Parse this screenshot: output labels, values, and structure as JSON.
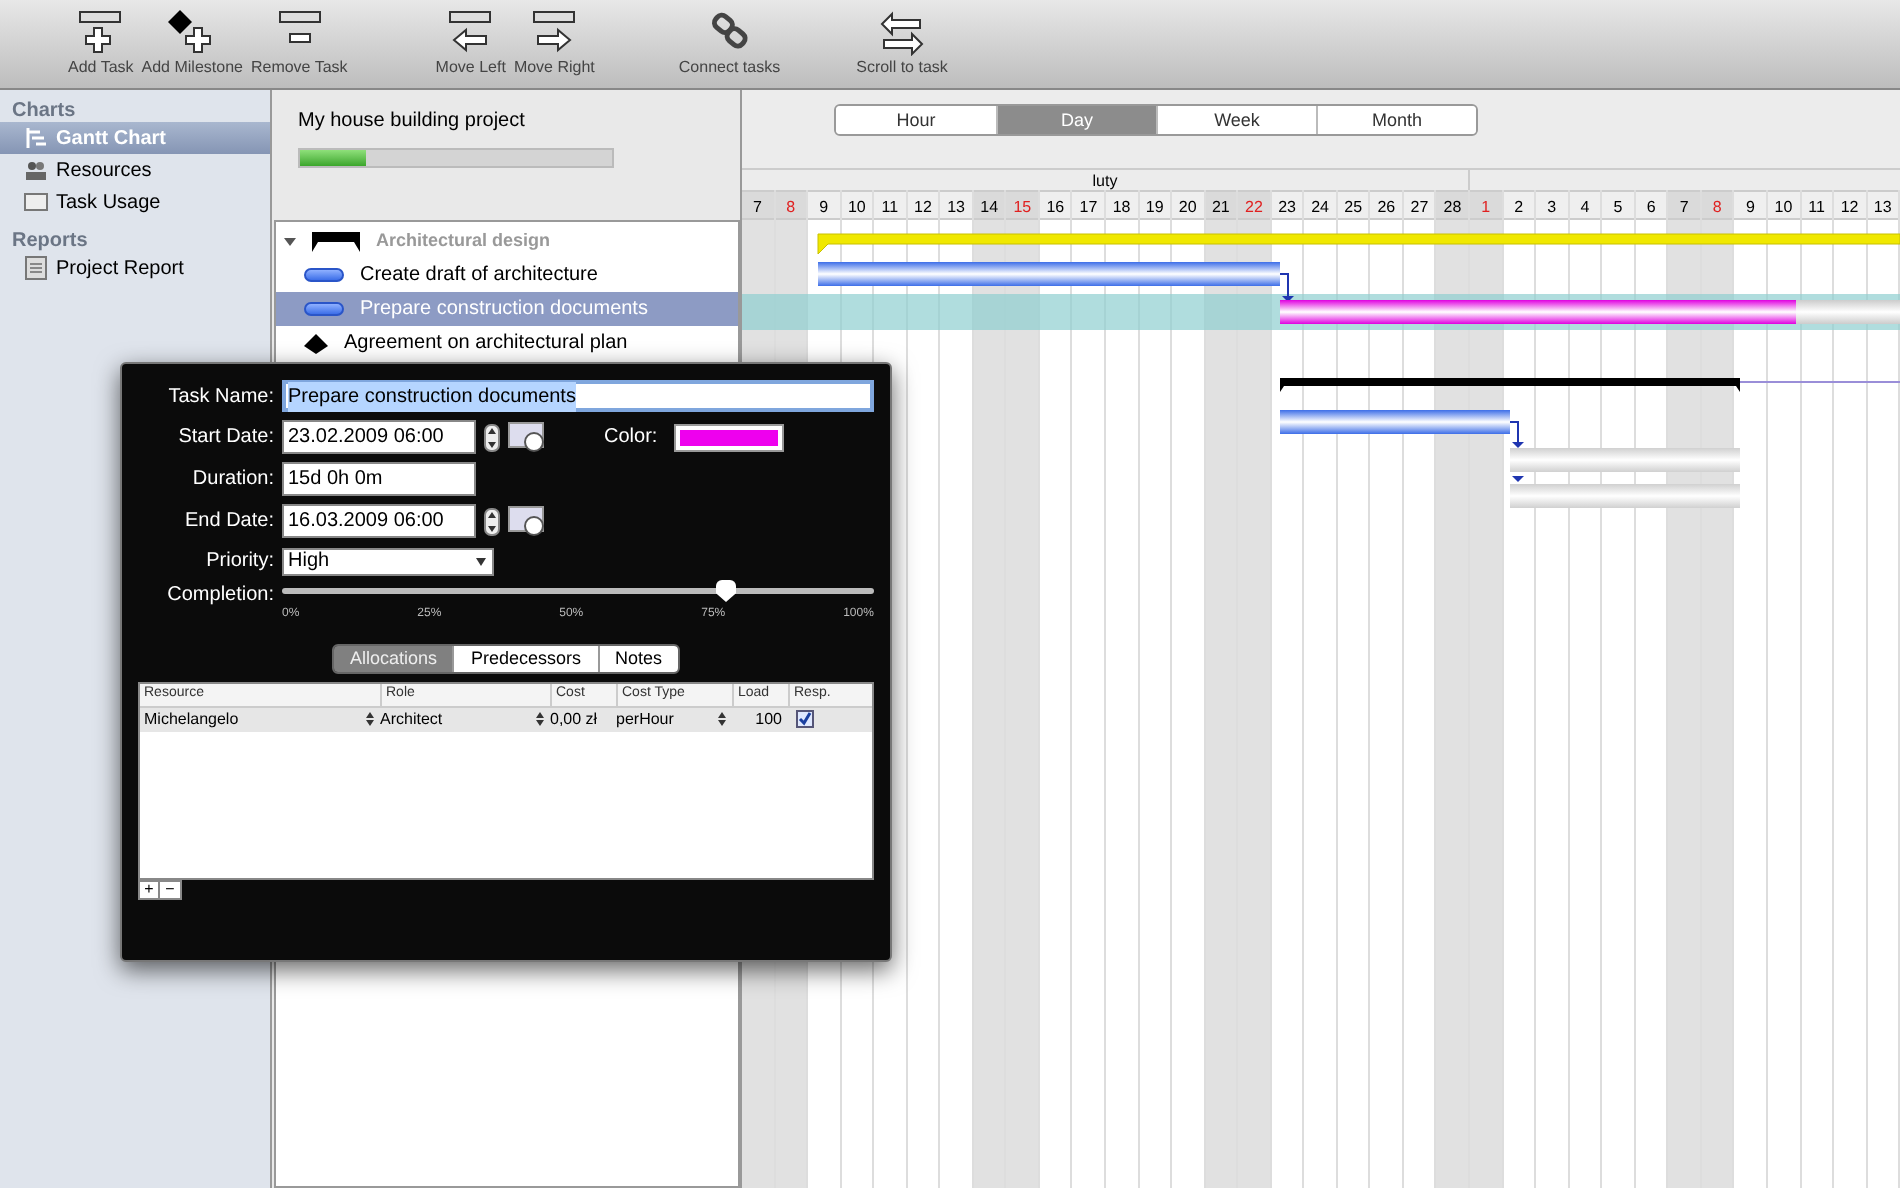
{
  "toolbar": [
    {
      "label": "Add Task",
      "kind": "add-task"
    },
    {
      "label": "Add Milestone",
      "kind": "add-milestone"
    },
    {
      "label": "Remove Task",
      "kind": "remove-task"
    },
    {
      "label": "Move Left",
      "kind": "move-left"
    },
    {
      "label": "Move Right",
      "kind": "move-right"
    },
    {
      "label": "Connect tasks",
      "kind": "connect"
    },
    {
      "label": "Scroll to task",
      "kind": "scroll"
    }
  ],
  "sidebar": {
    "sections": [
      {
        "title": "Charts",
        "items": [
          {
            "label": "Gantt Chart",
            "kind": "gantt",
            "selected": true
          },
          {
            "label": "Resources",
            "kind": "resources",
            "selected": false
          },
          {
            "label": "Task Usage",
            "kind": "usage",
            "selected": false
          }
        ]
      },
      {
        "title": "Reports",
        "items": [
          {
            "label": "Project Report",
            "kind": "report",
            "selected": false
          }
        ]
      }
    ]
  },
  "project": {
    "title": "My house building project",
    "level": 0.21
  },
  "tasks": [
    {
      "label": "Architectural design",
      "kind": "group",
      "expanded": true,
      "selected": false,
      "children": [
        {
          "label": "Create draft of architecture",
          "kind": "task",
          "selected": false
        },
        {
          "label": "Prepare construction documents",
          "kind": "task",
          "selected": true
        },
        {
          "label": "Agreement on architectural plan",
          "kind": "milestone",
          "selected": false
        }
      ]
    }
  ],
  "scale_tabs": [
    {
      "label": "Hour",
      "selected": false
    },
    {
      "label": "Day",
      "selected": true
    },
    {
      "label": "Week",
      "selected": false
    },
    {
      "label": "Month",
      "selected": false
    }
  ],
  "month": "luty",
  "days": [
    {
      "label": "7",
      "weekend": true,
      "sunday": false
    },
    {
      "label": "8",
      "weekend": true,
      "sunday": true
    },
    {
      "label": "9",
      "weekend": false,
      "sunday": false
    },
    {
      "label": "10",
      "weekend": false,
      "sunday": false
    },
    {
      "label": "11",
      "weekend": false,
      "sunday": false
    },
    {
      "label": "12",
      "weekend": false,
      "sunday": false
    },
    {
      "label": "13",
      "weekend": false,
      "sunday": false
    },
    {
      "label": "14",
      "weekend": true,
      "sunday": false
    },
    {
      "label": "15",
      "weekend": true,
      "sunday": true
    },
    {
      "label": "16",
      "weekend": false,
      "sunday": false
    },
    {
      "label": "17",
      "weekend": false,
      "sunday": false
    },
    {
      "label": "18",
      "weekend": false,
      "sunday": false
    },
    {
      "label": "19",
      "weekend": false,
      "sunday": false
    },
    {
      "label": "20",
      "weekend": false,
      "sunday": false
    },
    {
      "label": "21",
      "weekend": true,
      "sunday": false
    },
    {
      "label": "22",
      "weekend": true,
      "sunday": true
    },
    {
      "label": "23",
      "weekend": false,
      "sunday": false
    },
    {
      "label": "24",
      "weekend": false,
      "sunday": false
    },
    {
      "label": "25",
      "weekend": false,
      "sunday": false
    },
    {
      "label": "26",
      "weekend": false,
      "sunday": false
    },
    {
      "label": "27",
      "weekend": false,
      "sunday": false
    },
    {
      "label": "28",
      "weekend": true,
      "sunday": false
    },
    {
      "label": "1",
      "weekend": true,
      "sunday": true
    },
    {
      "label": "2",
      "weekend": false,
      "sunday": false
    },
    {
      "label": "3",
      "weekend": false,
      "sunday": false
    },
    {
      "label": "4",
      "weekend": false,
      "sunday": false
    },
    {
      "label": "5",
      "weekend": false,
      "sunday": false
    },
    {
      "label": "6",
      "weekend": false,
      "sunday": false
    },
    {
      "label": "7",
      "weekend": true,
      "sunday": false
    },
    {
      "label": "8",
      "weekend": true,
      "sunday": true
    },
    {
      "label": "9",
      "weekend": false,
      "sunday": false
    },
    {
      "label": "10",
      "weekend": false,
      "sunday": false
    },
    {
      "label": "11",
      "weekend": false,
      "sunday": false
    },
    {
      "label": "12",
      "weekend": false,
      "sunday": false
    },
    {
      "label": "13",
      "weekend": false,
      "sunday": false
    }
  ],
  "dialog": {
    "task_name_label": "Task Name:",
    "task_name": "Prepare construction documents",
    "start_label": "Start Date:",
    "start": "23.02.2009 06:00",
    "color_label": "Color:",
    "color": "#ee00ee",
    "duration_label": "Duration:",
    "duration": "15d 0h 0m",
    "end_label": "End Date:",
    "end": "16.03.2009 06:00",
    "priority_label": "Priority:",
    "priority": "High",
    "completion_label": "Completion:",
    "completion": {
      "level": 0.75,
      "ticks": [
        "0%",
        "25%",
        "50%",
        "75%",
        "100%"
      ]
    },
    "tabs": [
      {
        "label": "Allocations",
        "selected": true
      },
      {
        "label": "Predecessors",
        "selected": false
      },
      {
        "label": "Notes",
        "selected": false
      }
    ],
    "table": {
      "columns": [
        "Resource",
        "Role",
        "Cost",
        "Cost Type",
        "Load",
        "Resp."
      ],
      "rows": [
        {
          "resource": "Michelangelo",
          "role": "Architect",
          "cost": "0,00 zł",
          "cost_type": "perHour",
          "load": "100",
          "resp": true
        }
      ]
    },
    "add_button": "+",
    "remove_button": "−"
  }
}
